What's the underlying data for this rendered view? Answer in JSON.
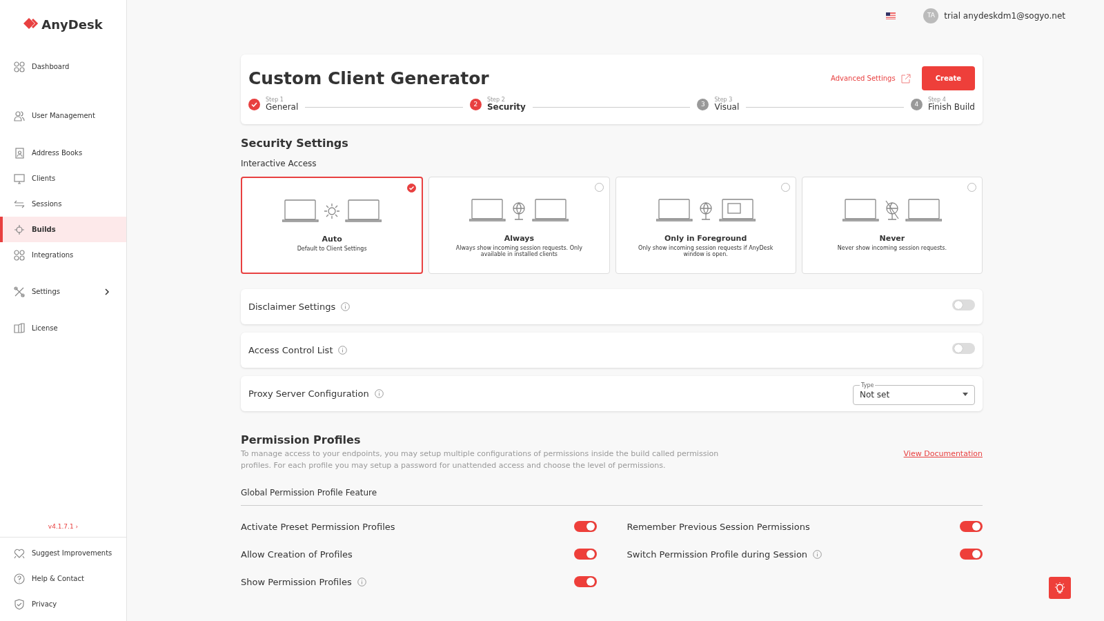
{
  "brand": "AnyDesk",
  "sidebar": {
    "items": [
      {
        "label": "Dashboard",
        "selected": false
      },
      {
        "label": "User Management",
        "selected": false
      },
      {
        "label": "Address Books",
        "selected": false
      },
      {
        "label": "Clients",
        "selected": false
      },
      {
        "label": "Sessions",
        "selected": false
      },
      {
        "label": "Builds",
        "selected": true
      },
      {
        "label": "Integrations",
        "selected": false
      },
      {
        "label": "Settings",
        "selected": false,
        "submenu": true
      },
      {
        "label": "License",
        "selected": false
      }
    ],
    "version": "v4.1.7.1 ›",
    "footer_items": [
      {
        "label": "Suggest Improvements"
      },
      {
        "label": "Help & Contact"
      },
      {
        "label": "Privacy"
      }
    ]
  },
  "topbar": {
    "avatar": "TA",
    "user": "trial anydeskdm1@sogyo.net"
  },
  "header": {
    "title": "Custom Client Generator",
    "advanced_link": "Advanced Settings",
    "create_button": "Create",
    "steps": [
      {
        "step": "Step 1",
        "label": "General",
        "done": true,
        "selected": false
      },
      {
        "number": "2",
        "step": "Step 2",
        "label": "Security",
        "done": false,
        "selected": true
      },
      {
        "number": "3",
        "step": "Step 3",
        "label": "Visual",
        "done": false,
        "selected": false
      },
      {
        "number": "4",
        "step": "Step 4",
        "label": "Finish Build",
        "done": false,
        "selected": false
      }
    ]
  },
  "security": {
    "title": "Security Settings",
    "subtitle": "Interactive Access",
    "options": [
      {
        "title": "Auto",
        "description": "Default to Client Settings",
        "selected": true
      },
      {
        "title": "Always",
        "description": "Always show incoming session requests. Only available in installed clients",
        "selected": false
      },
      {
        "title": "Only in Foreground",
        "description": "Only show incoming session requests if AnyDesk window is open.",
        "selected": false
      },
      {
        "title": "Never",
        "description": "Never show incoming session requests.",
        "selected": false
      }
    ],
    "rows": [
      {
        "label": "Disclaimer Settings",
        "kind": "toggle",
        "on": false
      },
      {
        "label": "Access Control List",
        "kind": "toggle",
        "on": false
      },
      {
        "label": "Proxy Server Configuration",
        "kind": "select",
        "field_label": "Type",
        "value": "Not set"
      }
    ]
  },
  "permissions": {
    "title": "Permission Profiles",
    "description": "To manage access to your endpoints, you may setup multiple configurations of permissions inside the build called permission profiles. For each profile you may setup a password for unattended access and choose the level of permissions.",
    "doc_link": "View Documentation",
    "subtitle": "Global Permission Profile Feature",
    "toggles": [
      {
        "label": "Activate Preset Permission Profiles",
        "on": true,
        "info": false
      },
      {
        "label": "Remember Previous Session Permissions",
        "on": true,
        "info": false
      },
      {
        "label": "Allow Creation of Profiles",
        "on": true,
        "info": false
      },
      {
        "label": "Switch Permission Profile during Session",
        "on": true,
        "info": true
      },
      {
        "label": "Show Permission Profiles",
        "on": true,
        "info": true
      }
    ]
  }
}
